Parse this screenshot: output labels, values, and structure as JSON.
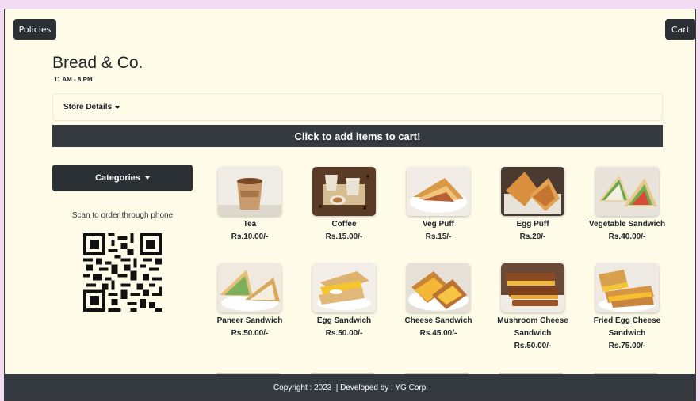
{
  "header": {
    "policies_label": "Policies",
    "cart_label": "Cart"
  },
  "store": {
    "name": "Bread & Co.",
    "hours": "11 AM - 8 PM",
    "details_label": "Store Details"
  },
  "banner": {
    "add_items_text": "Click to add items to cart!"
  },
  "sidebar": {
    "categories_label": "Categories",
    "scan_text": "Scan to order through phone"
  },
  "menu": {
    "items": [
      {
        "name": "Tea",
        "price": "Rs.10.00/-",
        "icon": "tea-cup"
      },
      {
        "name": "Coffee",
        "price": "Rs.15.00/-",
        "icon": "coffee-cups"
      },
      {
        "name": "Veg Puff",
        "price": "Rs.15/-",
        "icon": "veg-puff"
      },
      {
        "name": "Egg Puff",
        "price": "Rs.20/-",
        "icon": "egg-puff"
      },
      {
        "name": "Vegetable Sandwich",
        "price": "Rs.40.00/-",
        "icon": "veg-sandwich"
      },
      {
        "name": "Paneer Sandwich",
        "price": "Rs.50.00/-",
        "icon": "paneer-sandwich"
      },
      {
        "name": "Egg Sandwich",
        "price": "Rs.50.00/-",
        "icon": "egg-sandwich"
      },
      {
        "name": "Cheese Sandwich",
        "price": "Rs.45.00/-",
        "icon": "cheese-sandwich"
      },
      {
        "name": "Mushroom Cheese Sandwich",
        "price": "Rs.50.00/-",
        "icon": "mushroom-sandwich"
      },
      {
        "name": "Fried Egg Cheese Sandwich",
        "price": "Rs.75.00/-",
        "icon": "fried-egg-sandwich"
      }
    ]
  },
  "footer": {
    "text": "Copyright : 2023 || Developed by : YG Corp."
  },
  "colors": {
    "page_bg": "#fefbe9",
    "dark": "#343a40",
    "outer_bg": "#f3dcf3"
  }
}
